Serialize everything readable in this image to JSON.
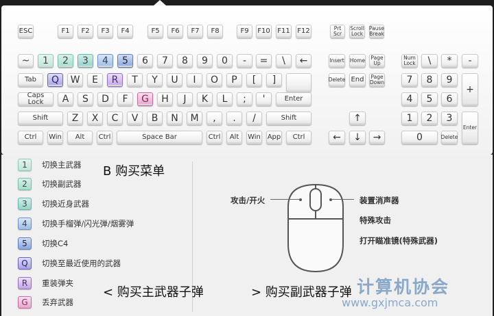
{
  "keyboard": {
    "fn_row": [
      {
        "id": "esc",
        "label": "ESC"
      },
      {
        "id": "f1",
        "label": "F1"
      },
      {
        "id": "f2",
        "label": "F2"
      },
      {
        "id": "f3",
        "label": "F3"
      },
      {
        "id": "f4",
        "label": "F4"
      },
      {
        "id": "f5",
        "label": "F5"
      },
      {
        "id": "f6",
        "label": "F6"
      },
      {
        "id": "f7",
        "label": "F7"
      },
      {
        "id": "f8",
        "label": "F8"
      },
      {
        "id": "f9",
        "label": "F9"
      },
      {
        "id": "f10",
        "label": "F10"
      },
      {
        "id": "f11",
        "label": "F11"
      },
      {
        "id": "f12",
        "label": "F12"
      },
      {
        "id": "prtscr",
        "label": "Prt\nScr"
      },
      {
        "id": "scrlock",
        "label": "Scroll\nLock"
      },
      {
        "id": "pause",
        "label": "Pause\nBreak"
      }
    ],
    "number_row": [
      "~",
      "1",
      "2",
      "3",
      "4",
      "5",
      "6",
      "7",
      "8",
      "9",
      "0",
      "-",
      "=",
      "\\",
      "←"
    ],
    "qwerty_row": [
      "Tab",
      "Q",
      "W",
      "E",
      "R",
      "T",
      "Y",
      "U",
      "I",
      "O",
      "P",
      "[",
      "]"
    ],
    "home_row": [
      "Caps Lock",
      "A",
      "S",
      "D",
      "F",
      "G",
      "H",
      "J",
      "K",
      "L",
      ";",
      "'",
      "Enter"
    ],
    "shift_row": [
      "Shift",
      "Z",
      "X",
      "C",
      "V",
      "B",
      "N",
      "M",
      ",",
      ".",
      "/",
      "Shift"
    ],
    "bottom_row": [
      "Ctrl",
      "Win",
      "Alt",
      "Ctrl",
      "Space Bar",
      "Ctrl",
      "Alt",
      "Win",
      "App",
      "Ctrl"
    ],
    "nav_cluster": [
      "Insert",
      "Home",
      "Page\nUp",
      "Delete",
      "End",
      "Page\nDown",
      "↑",
      "←",
      "↓",
      "→"
    ],
    "numpad": [
      "Num\nLock",
      "\\",
      "*",
      "-",
      "7",
      "8",
      "9",
      "+",
      "4",
      "5",
      "6",
      "1",
      "2",
      "3",
      "Enter",
      "0",
      "Delete"
    ]
  },
  "colors": {
    "k1": "#bfe6d7",
    "k2": "#a7dccd",
    "k3": "#94d4c9",
    "k4": "#9fbde2",
    "k5": "#8aa6dd",
    "kq": "#a8a2e2",
    "kr": "#c3a6e2",
    "kg": "#e6a7cc"
  },
  "legend": [
    {
      "key": "1",
      "label": "切换主武器",
      "style": "k1"
    },
    {
      "key": "2",
      "label": "切换副武器",
      "style": "k2"
    },
    {
      "key": "3",
      "label": "切换近身武器",
      "style": "k3"
    },
    {
      "key": "4",
      "label": "切换手榴弹/闪光弹/烟雾弹",
      "style": "k4"
    },
    {
      "key": "5",
      "label": "切换C4",
      "style": "k5"
    },
    {
      "key": "Q",
      "label": "切换至最近使用的武器",
      "style": "kq"
    },
    {
      "key": "R",
      "label": "重装弹夹",
      "style": "kr"
    },
    {
      "key": "G",
      "label": "丢弃武器",
      "style": "kg"
    }
  ],
  "notes": {
    "buy_menu": "B 购买菜单",
    "buy_primary_ammo": "< 购买主武器子弹",
    "buy_secondary_ammo": "> 购买副武器子弹"
  },
  "mouse": {
    "left": "攻击/开火",
    "right_1": "装置消声器",
    "right_2": "特殊攻击",
    "right_3": "打开瞄准镜(特殊武器)"
  },
  "watermark": {
    "text": "计算机协会",
    "url": "www.gxjmca.com"
  }
}
